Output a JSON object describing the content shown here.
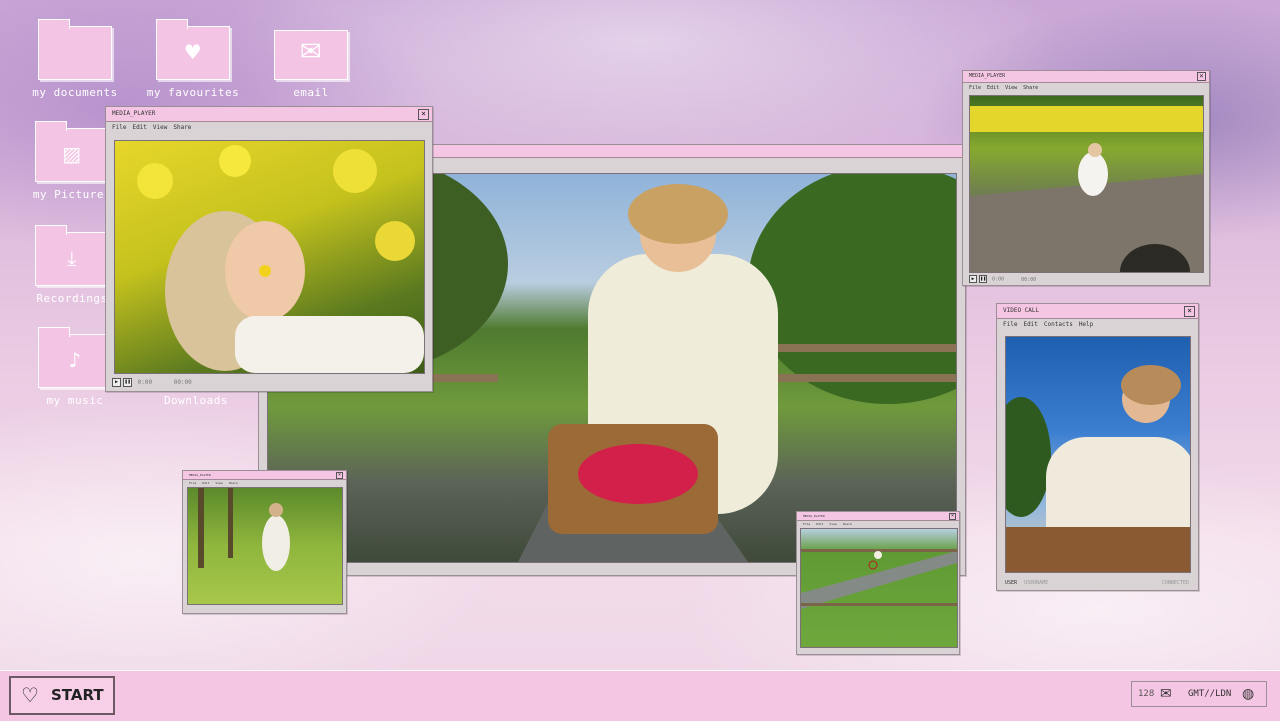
{
  "desktop": {
    "icons": [
      {
        "label": "my documents",
        "icon": "folder-icon",
        "glyph": ""
      },
      {
        "label": "my favourites",
        "icon": "heart-folder-icon",
        "glyph": "♥"
      },
      {
        "label": "email",
        "icon": "envelope-icon",
        "glyph": "✉"
      },
      {
        "label": "my Pictures",
        "icon": "picture-folder-icon",
        "glyph": "▨"
      },
      {
        "label": "Recordings",
        "icon": "download-folder-icon",
        "glyph": "⤓"
      },
      {
        "label": "my music",
        "icon": "music-folder-icon",
        "glyph": "♪"
      },
      {
        "label": "Downloads",
        "icon": "downloads-folder-icon",
        "glyph": ""
      }
    ]
  },
  "windows": {
    "media_main": {
      "title": "MEDIA_PLAYER",
      "close": "×",
      "menu": [
        "File",
        "Edit",
        "View",
        "Share"
      ],
      "play": "▶",
      "pause": "❚❚",
      "time": "0:00",
      "status": "00:00"
    },
    "media_top_right": {
      "title": "MEDIA_PLAYER",
      "close": "×",
      "menu": [
        "File",
        "Edit",
        "View",
        "Share"
      ],
      "play": "▶",
      "pause": "❚❚",
      "time": "0:00",
      "status": "00:00"
    },
    "video_call": {
      "title": "VIDEO CALL",
      "close": "×",
      "menu": [
        "File",
        "Edit",
        "Contacts",
        "Help"
      ],
      "user_label": "USER",
      "user_value": "USERNAME",
      "status": "CONNECTED"
    },
    "small_left": {
      "title": "MEDIA_PLAYER",
      "close": "×",
      "menu": [
        "File",
        "Edit",
        "View",
        "Share"
      ]
    },
    "small_bottom": {
      "title": "MEDIA_PLAYER",
      "close": "×",
      "menu": [
        "File",
        "Edit",
        "View",
        "Share"
      ]
    }
  },
  "taskbar": {
    "start_label": "START",
    "start_icon": "heart-outline-icon",
    "tray_count": "128",
    "tray_timezone": "GMT//LDN",
    "tray_icons": [
      "envelope-icon",
      "globe-icon"
    ]
  },
  "colors": {
    "accent": "#f5c6e3",
    "window_body": "#d9d3d6",
    "desktop_sky": "#e7c7e1"
  }
}
